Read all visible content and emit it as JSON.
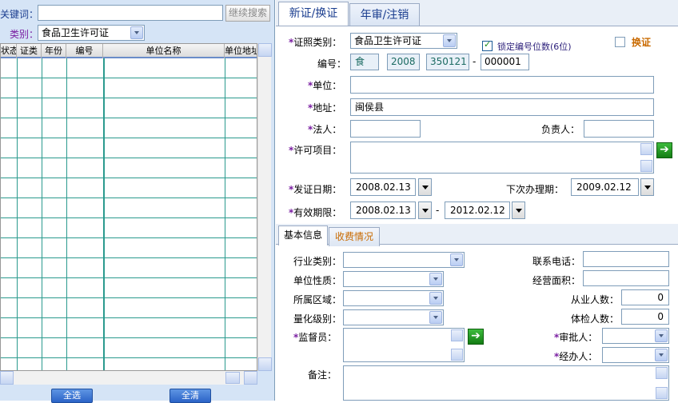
{
  "left": {
    "keyword_label": "关键词：",
    "keyword_value": "",
    "continue_search": "继续搜索",
    "category_label": "类别：",
    "category_value": "食品卫生许可证",
    "columns": [
      "状态",
      "证类",
      "年份",
      "编号",
      "单位名称",
      "单位地址"
    ],
    "select_all": "全选",
    "clear_all": "全清"
  },
  "tabs": {
    "new_renew": "新证/换证",
    "annual_cancel": "年审/注销"
  },
  "form": {
    "license_type_label": "证照类别：",
    "license_type_value": "食品卫生许可证",
    "lock_digits_label": "锁定编号位数(6位)",
    "renew_label": "换证",
    "number_label": "编号：",
    "num_prefix": "食",
    "num_year": "2008",
    "num_area": "350121",
    "num_dash": "-",
    "num_seq": "000001",
    "unit_label": "单位：",
    "unit_value": "",
    "address_label": "地址：",
    "address_value": "闽侯县",
    "legal_label": "法人：",
    "responsible_label": "负责人：",
    "permit_label": "许可项目：",
    "issue_date_label": "发证日期：",
    "issue_date": "2008.02.13",
    "next_date_label": "下次办理期：",
    "next_date": "2009.02.12",
    "valid_label": "有效期限：",
    "valid_from": "2008.02.13",
    "valid_dash": "-",
    "valid_to": "2012.02.12"
  },
  "subtabs": {
    "basic": "基本信息",
    "fees": "收费情况"
  },
  "basic": {
    "industry_label": "行业类别：",
    "unit_nature_label": "单位性质：",
    "region_label": "所属区域：",
    "quant_level_label": "量化级别：",
    "supervisor_label": "监督员：",
    "phone_label": "联系电话：",
    "area_label": "经营面积：",
    "employees_label": "从业人数：",
    "employees_value": "0",
    "checked_label": "体检人数：",
    "checked_value": "0",
    "approver_label": "审批人：",
    "handler_label": "经办人：",
    "remark_label": "备注："
  },
  "colors": {
    "panel": "#d5e4f6",
    "grid_line": "#2b9a8e",
    "accent_tab": "#c96a00",
    "required_star": "#7a1fa2"
  }
}
